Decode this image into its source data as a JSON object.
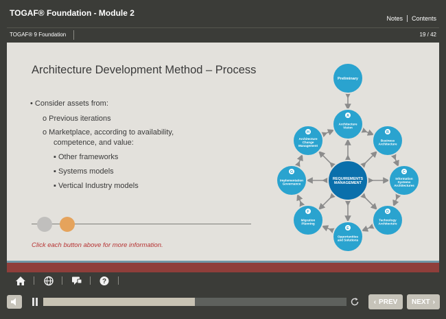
{
  "header": {
    "app_title": "TOGAF® Foundation - Module 2",
    "notes_label": "Notes",
    "contents_label": "Contents",
    "course_name": "TOGAF® 9 Foundation",
    "page_counter": "19 / 42"
  },
  "slide": {
    "title": "Architecture Development Method – Process",
    "bullets": [
      "• Consider assets from:",
      "o   Previous iterations",
      "o   Marketplace, according to availability,",
      "competence, and value:",
      "▪   Other frameworks",
      "▪   Systems models",
      "▪   Vertical Industry models"
    ],
    "click_hint": "Click each button above for more information.",
    "diagram": {
      "center": "REQUIREMENTS MANAGEMENT",
      "preliminary": "Preliminary",
      "phases": [
        {
          "letter": "A",
          "name": "Architecture Vision"
        },
        {
          "letter": "B",
          "name": "Business Architecture"
        },
        {
          "letter": "C",
          "name": "Information Systems Architectures"
        },
        {
          "letter": "D",
          "name": "Technology Architecture"
        },
        {
          "letter": "E",
          "name": "Opportunities and Solutions"
        },
        {
          "letter": "F",
          "name": "Migration Planning"
        },
        {
          "letter": "G",
          "name": "Implementation Governance"
        },
        {
          "letter": "H",
          "name": "Architecture Change Management"
        }
      ]
    }
  },
  "toolbar": {
    "icons": [
      "home-icon",
      "globe-icon",
      "chat-icon",
      "help-icon"
    ]
  },
  "player": {
    "progress": 0.5,
    "prev_label": "PREV",
    "next_label": "NEXT"
  },
  "colors": {
    "background": "#3b3c38",
    "slide_bg": "#e3e1dc",
    "node_light": "#2aa3cf",
    "node_center": "#0a6fab",
    "accent_red": "#8f3e3a",
    "hint_red": "#b63333",
    "timeline_dot_orange": "#e5a35c"
  }
}
